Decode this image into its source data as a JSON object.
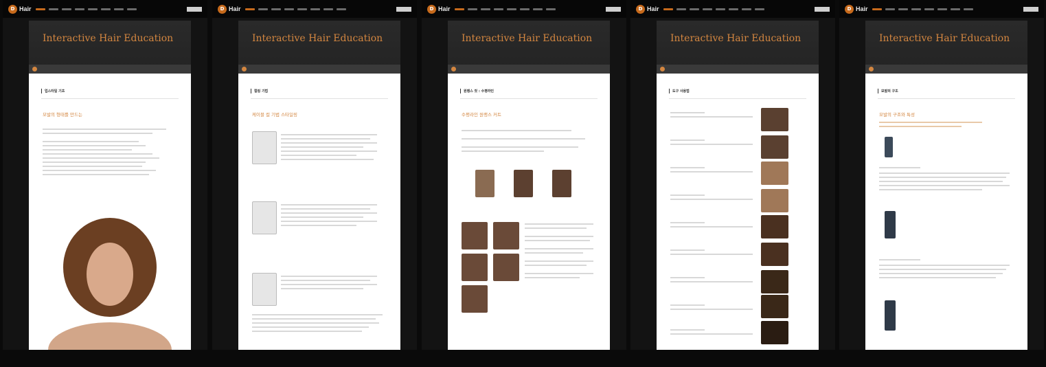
{
  "panels": [
    {
      "title": "Interactive Hair Education",
      "logo": "Hair",
      "section": "업스타일 기초",
      "heading": "모발의 형태를 만드는"
    },
    {
      "title": "Interactive Hair Education",
      "logo": "Hair",
      "section": "컬링 기법",
      "heading": "케이블 컬 기법 스타일링"
    },
    {
      "title": "Interactive Hair Education",
      "logo": "Hair",
      "section": "원랭스 컷 : 수평라인",
      "heading": "수평라인 원랭스 커트"
    },
    {
      "title": "Interactive Hair Education",
      "logo": "Hair",
      "section": "도구 사용법",
      "heading": ""
    },
    {
      "title": "Interactive Hair Education",
      "logo": "Hair",
      "section": "모발의 구조",
      "heading": "모발의 구조와 특성"
    }
  ],
  "colors": {
    "accent": "#d38640",
    "background": "#0a0a0a"
  }
}
